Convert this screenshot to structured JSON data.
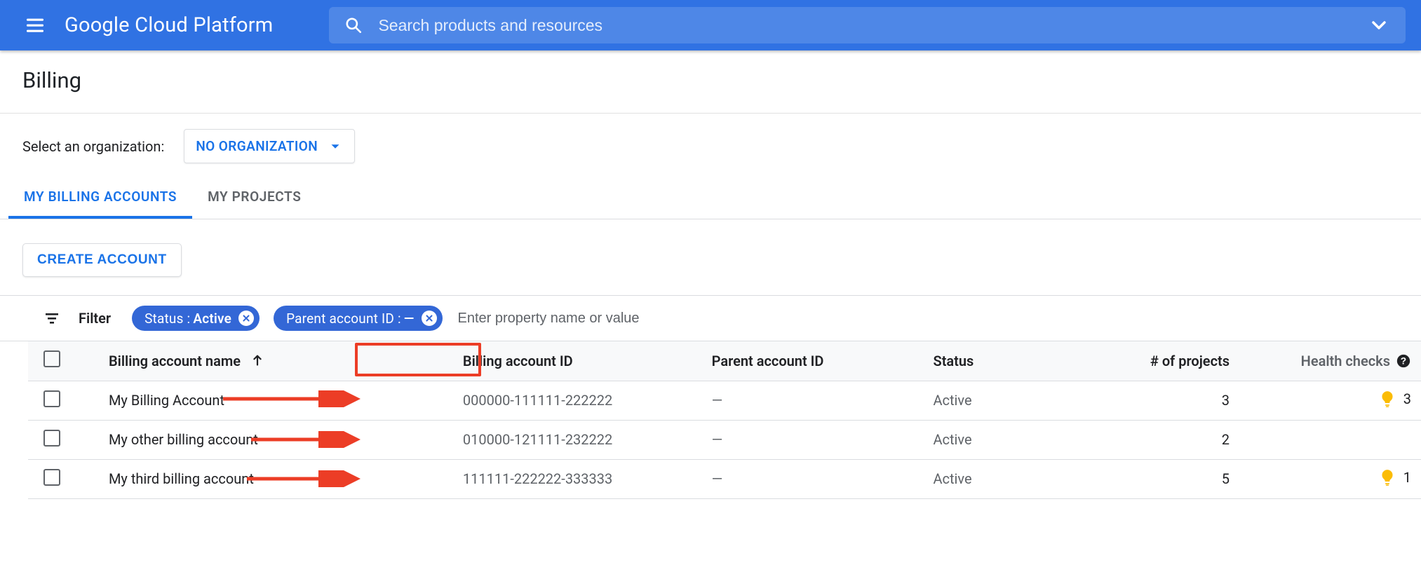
{
  "appbar": {
    "brand": "Google Cloud Platform",
    "search_placeholder": "Search products and resources"
  },
  "page": {
    "title": "Billing",
    "org_label": "Select an organization:",
    "org_picker": "NO ORGANIZATION"
  },
  "tabs": {
    "accounts": "MY BILLING ACCOUNTS",
    "projects": "MY PROJECTS"
  },
  "actions": {
    "create_account": "CREATE ACCOUNT"
  },
  "filter": {
    "label": "Filter",
    "input_placeholder": "Enter property name or value",
    "chips": {
      "status_key": "Status : ",
      "status_value": "Active",
      "parent_key": "Parent account ID : ",
      "parent_value": "—"
    }
  },
  "columns": {
    "name": "Billing account name",
    "id": "Billing account ID",
    "parent": "Parent account ID",
    "status": "Status",
    "projects": "# of projects",
    "health": "Health checks"
  },
  "rows": [
    {
      "name": "My Billing Account",
      "id": "000000-111111-222222",
      "parent": "—",
      "status": "Active",
      "projects": "3",
      "health": "3",
      "health_has_bulb": true
    },
    {
      "name": "My other billing account",
      "id": "010000-121111-232222",
      "parent": "—",
      "status": "Active",
      "projects": "2",
      "health": "",
      "health_has_bulb": false
    },
    {
      "name": "My third billing account",
      "id": "111111-222222-333333",
      "parent": "—",
      "status": "Active",
      "projects": "5",
      "health": "1",
      "health_has_bulb": true
    }
  ],
  "colors": {
    "brand_blue": "#3072e3",
    "link_blue": "#1a73e8",
    "chip_blue": "#3367d6",
    "bulb_orange": "#fbbc04",
    "anno_red": "#ec3d26"
  }
}
